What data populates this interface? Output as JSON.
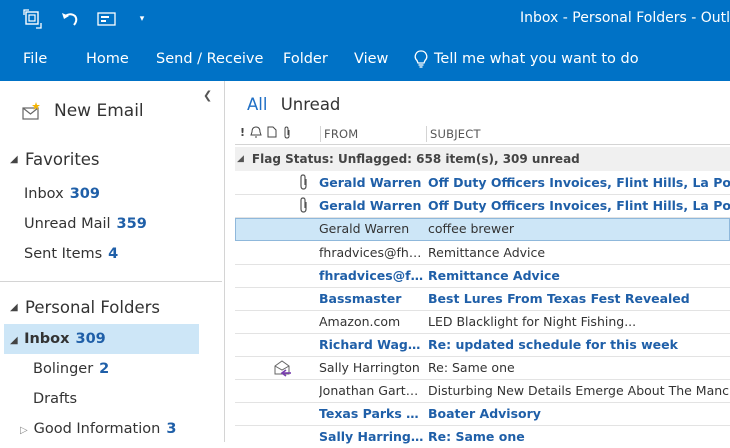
{
  "titlebar": {
    "title": "Inbox - Personal Folders  -  Outlook",
    "qat": [
      "send-receive-all-icon",
      "undo-icon",
      "quick-access-customize-icon",
      "qat-dropdown-icon"
    ]
  },
  "ribbon": {
    "tabs": [
      "File",
      "Home",
      "Send / Receive",
      "Folder",
      "View"
    ],
    "tell_me": "Tell me what you want to do"
  },
  "nav": {
    "new_email": "New Email",
    "favorites_header": "Favorites",
    "favorites": [
      {
        "label": "Inbox",
        "count": "309"
      },
      {
        "label": "Unread Mail",
        "count": "359"
      },
      {
        "label": "Sent Items",
        "count": "4"
      }
    ],
    "personal_header": "Personal Folders",
    "personal": [
      {
        "label": "Inbox",
        "count": "309"
      },
      {
        "label": "Bolinger",
        "count": "2"
      },
      {
        "label": "Drafts",
        "count": ""
      },
      {
        "label": "Good Information",
        "count": "3"
      }
    ]
  },
  "list": {
    "filter_all": "All",
    "filter_unread": "Unread",
    "columns": {
      "from": "FROM",
      "subject": "SUBJECT"
    },
    "group_header": "Flag Status: Unflagged: 658 item(s), 309 unread",
    "messages": [
      {
        "from": "Gerald Warren",
        "subject": "Off Duty Officers Invoices, Flint Hills, La Porte Fr",
        "unread": true,
        "attachment": true
      },
      {
        "from": "Gerald Warren",
        "subject": "Off Duty Officers Invoices, Flint Hills, La Porte Fr",
        "unread": true,
        "attachment": true
      },
      {
        "from": "Gerald Warren",
        "subject": "coffee brewer",
        "unread": false,
        "selected": true
      },
      {
        "from": "fhradvices@fhr.c...",
        "subject": "Remittance Advice",
        "unread": false
      },
      {
        "from": "fhradvices@fhr...",
        "subject": "Remittance Advice",
        "unread": true
      },
      {
        "from": "Bassmaster",
        "subject": "Best Lures From Texas Fest Revealed",
        "unread": true
      },
      {
        "from": "Amazon.com",
        "subject": "LED Blacklight for Night Fishing...",
        "unread": false
      },
      {
        "from": "Richard Wagner",
        "subject": "Re: updated schedule for this week",
        "unread": true
      },
      {
        "from": "Sally Harrington",
        "subject": "Re: Same one",
        "unread": false,
        "replied": true
      },
      {
        "from": "Jonathan Garthw...",
        "subject": "Disturbing New Details Emerge About The Manches",
        "unread": false
      },
      {
        "from": "Texas Parks an...",
        "subject": "Boater Advisory",
        "unread": true
      },
      {
        "from": "Sally Harrington",
        "subject": "Re: Same one",
        "unread": true
      }
    ]
  }
}
